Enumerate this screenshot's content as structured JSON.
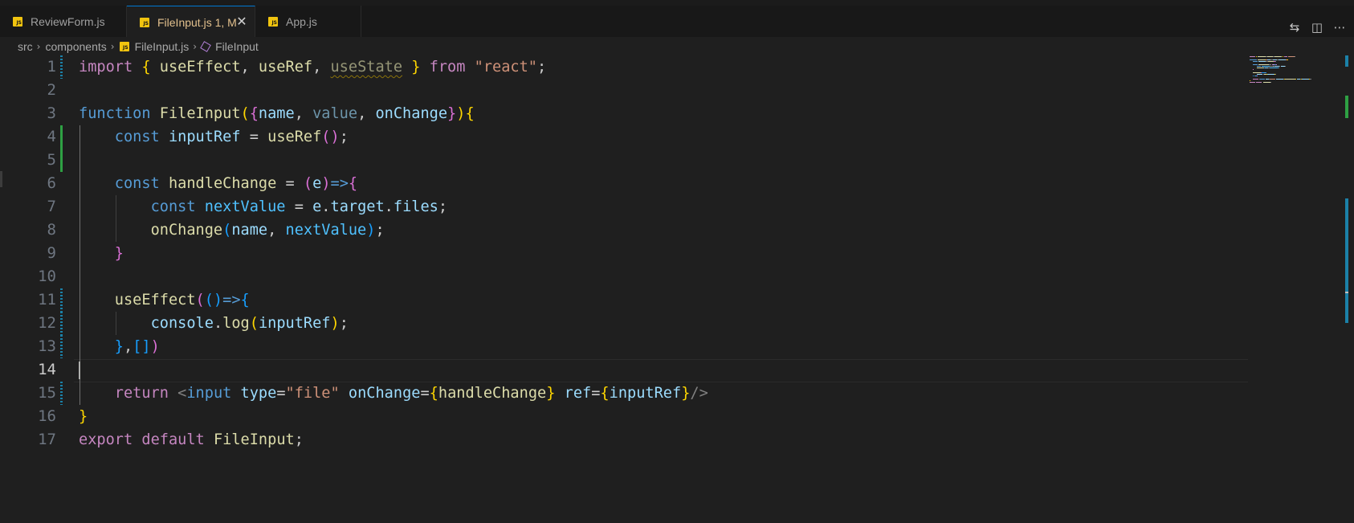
{
  "tabs": [
    {
      "label": "ReviewForm.js",
      "badge": "JS",
      "active": false
    },
    {
      "label": "FileInput.js 1, M",
      "badge": "JS",
      "active": true
    },
    {
      "label": "App.js",
      "badge": "JS",
      "active": false
    }
  ],
  "tab_close_glyph": "✕",
  "top_actions": [
    {
      "name": "compare-changes-icon",
      "glyph": "⇆"
    },
    {
      "name": "split-editor-icon",
      "glyph": "◫"
    },
    {
      "name": "more-actions-icon",
      "glyph": "⋯"
    }
  ],
  "breadcrumb": {
    "items": [
      "src",
      "components",
      "FileInput.js",
      "FileInput"
    ],
    "separator": "›"
  },
  "editor": {
    "current_line": 14,
    "line_numbers": [
      "1",
      "2",
      "3",
      "4",
      "5",
      "6",
      "7",
      "8",
      "9",
      "10",
      "11",
      "12",
      "13",
      "14",
      "15",
      "16",
      "17"
    ],
    "lines": [
      [
        [
          "kw",
          "import"
        ],
        [
          "pn",
          " "
        ],
        [
          "b1",
          "{"
        ],
        [
          "pn",
          " "
        ],
        [
          "fn",
          "useEffect"
        ],
        [
          "pn",
          ", "
        ],
        [
          "fn",
          "useRef"
        ],
        [
          "pn",
          ", "
        ],
        [
          "fn dim squig",
          "useState"
        ],
        [
          "pn",
          " "
        ],
        [
          "b1",
          "}"
        ],
        [
          "pn",
          " "
        ],
        [
          "kw",
          "from"
        ],
        [
          "pn",
          " "
        ],
        [
          "sr",
          "\"react\""
        ],
        [
          "pn",
          ";"
        ]
      ],
      [],
      [
        [
          "st",
          "function"
        ],
        [
          "pn",
          " "
        ],
        [
          "fn",
          "FileInput"
        ],
        [
          "b1",
          "("
        ],
        [
          "b2",
          "{"
        ],
        [
          "vr",
          "name"
        ],
        [
          "pn",
          ", "
        ],
        [
          "vr dim",
          "value"
        ],
        [
          "pn",
          ", "
        ],
        [
          "vr",
          "onChange"
        ],
        [
          "b2",
          "}"
        ],
        [
          "b1",
          ")"
        ],
        [
          "b1",
          "{"
        ]
      ],
      [
        [
          "pn",
          "    "
        ],
        [
          "st",
          "const"
        ],
        [
          "pn",
          " "
        ],
        [
          "vr",
          "inputRef"
        ],
        [
          "pn",
          " = "
        ],
        [
          "fn",
          "useRef"
        ],
        [
          "b2",
          "()"
        ],
        [
          "pn",
          ";"
        ]
      ],
      [],
      [
        [
          "pn",
          "    "
        ],
        [
          "st",
          "const"
        ],
        [
          "pn",
          " "
        ],
        [
          "fn",
          "handleChange"
        ],
        [
          "pn",
          " = "
        ],
        [
          "b2",
          "("
        ],
        [
          "vr",
          "e"
        ],
        [
          "b2",
          ")"
        ],
        [
          "st",
          "=>"
        ],
        [
          "b2",
          "{"
        ]
      ],
      [
        [
          "pn",
          "        "
        ],
        [
          "st",
          "const"
        ],
        [
          "pn",
          " "
        ],
        [
          "cn",
          "nextValue"
        ],
        [
          "pn",
          " = "
        ],
        [
          "vr",
          "e"
        ],
        [
          "pn",
          "."
        ],
        [
          "vr",
          "target"
        ],
        [
          "pn",
          "."
        ],
        [
          "vr",
          "files"
        ],
        [
          "pn",
          ";"
        ]
      ],
      [
        [
          "pn",
          "        "
        ],
        [
          "fn",
          "onChange"
        ],
        [
          "b3",
          "("
        ],
        [
          "vr",
          "name"
        ],
        [
          "pn",
          ", "
        ],
        [
          "cn",
          "nextValue"
        ],
        [
          "b3",
          ")"
        ],
        [
          "pn",
          ";"
        ]
      ],
      [
        [
          "pn",
          "    "
        ],
        [
          "b2",
          "}"
        ]
      ],
      [],
      [
        [
          "pn",
          "    "
        ],
        [
          "fn",
          "useEffect"
        ],
        [
          "b2",
          "("
        ],
        [
          "b3",
          "()"
        ],
        [
          "st",
          "=>"
        ],
        [
          "b3",
          "{"
        ]
      ],
      [
        [
          "pn",
          "        "
        ],
        [
          "vr",
          "console"
        ],
        [
          "pn",
          "."
        ],
        [
          "fn",
          "log"
        ],
        [
          "b1",
          "("
        ],
        [
          "vr",
          "inputRef"
        ],
        [
          "b1",
          ")"
        ],
        [
          "pn",
          ";"
        ]
      ],
      [
        [
          "pn",
          "    "
        ],
        [
          "b3",
          "}"
        ],
        [
          "pn",
          ","
        ],
        [
          "b3",
          "[]"
        ],
        [
          "b2",
          ")"
        ]
      ],
      [],
      [
        [
          "pn",
          "    "
        ],
        [
          "kw",
          "return"
        ],
        [
          "pn",
          " "
        ],
        [
          "tg",
          "<"
        ],
        [
          "ht",
          "input"
        ],
        [
          "pn",
          " "
        ],
        [
          "vr",
          "type"
        ],
        [
          "pn",
          "="
        ],
        [
          "sr",
          "\"file\""
        ],
        [
          "pn",
          " "
        ],
        [
          "vr",
          "onChange"
        ],
        [
          "pn",
          "="
        ],
        [
          "b1",
          "{"
        ],
        [
          "fn",
          "handleChange"
        ],
        [
          "b1",
          "}"
        ],
        [
          "pn",
          " "
        ],
        [
          "vr",
          "ref"
        ],
        [
          "pn",
          "="
        ],
        [
          "b1",
          "{"
        ],
        [
          "vr",
          "inputRef"
        ],
        [
          "b1",
          "}"
        ],
        [
          "tg",
          "/>"
        ]
      ],
      [
        [
          "b1",
          "}"
        ]
      ],
      [
        [
          "kw",
          "export"
        ],
        [
          "pn",
          " "
        ],
        [
          "kw",
          "default"
        ],
        [
          "pn",
          " "
        ],
        [
          "fn",
          "FileInput"
        ],
        [
          "pn",
          ";"
        ]
      ]
    ],
    "git_marks": [
      {
        "line": 1,
        "kind": "modified"
      },
      {
        "line": 4,
        "kind": "added"
      },
      {
        "line": 5,
        "kind": "added"
      },
      {
        "line": 11,
        "kind": "modified"
      },
      {
        "line": 12,
        "kind": "modified"
      },
      {
        "line": 13,
        "kind": "modified"
      },
      {
        "line": 15,
        "kind": "modified"
      }
    ]
  },
  "colors": {
    "editor_bg": "#1f1f1f",
    "tabbar_bg": "#181818",
    "accent": "#0078d4",
    "modified_tab_text": "#e2c08d",
    "git_added": "#2ea043",
    "git_modified": "#1b81a8"
  }
}
